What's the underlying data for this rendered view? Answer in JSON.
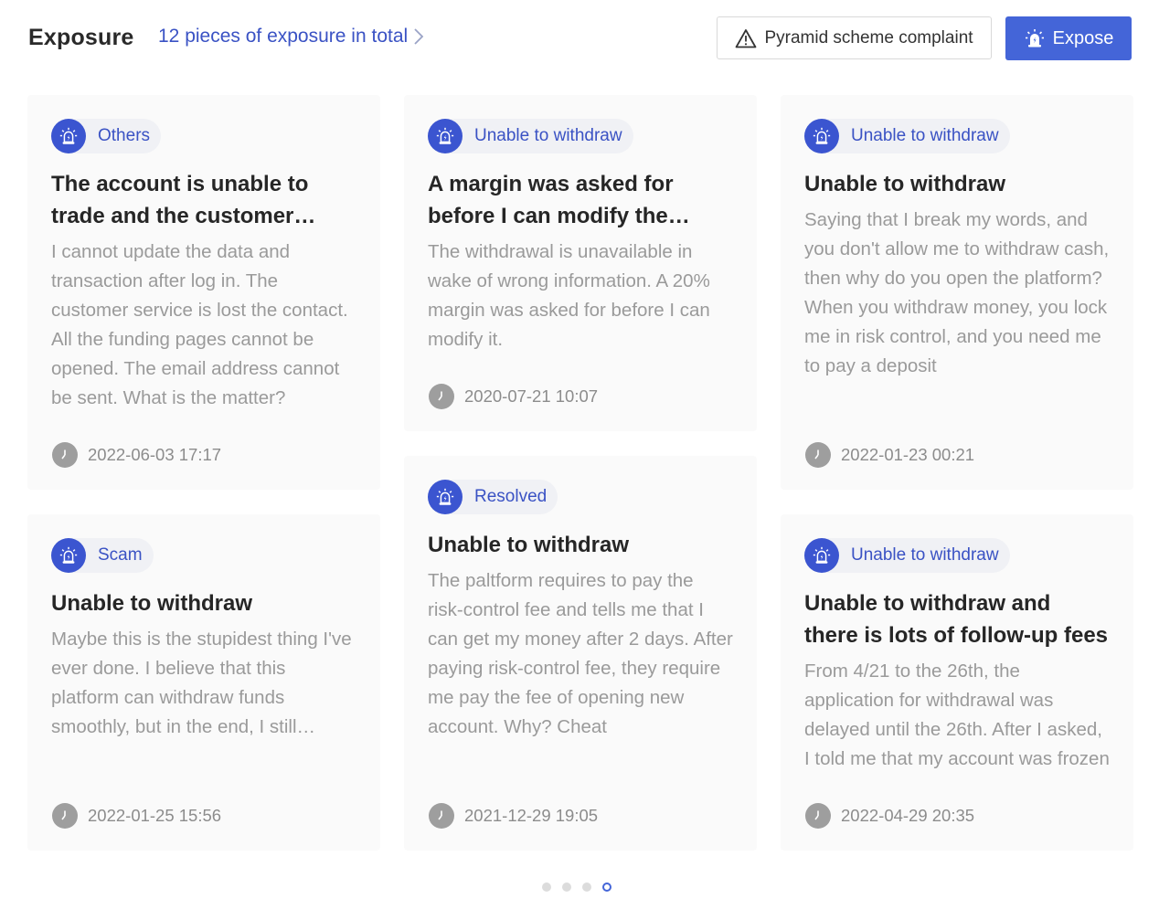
{
  "header": {
    "title": "Exposure",
    "total_link": "12 pieces of exposure in total",
    "complaint_button": "Pyramid scheme complaint",
    "expose_button": "Expose"
  },
  "colors": {
    "accent": "#4465d8",
    "tag_text": "#3a52c4",
    "body_text": "#9a9a9a",
    "card_bg": "#fafafa"
  },
  "cards": [
    {
      "tag": "Others",
      "title": "The account is unable to trade and the customer service is lost the contact",
      "body": "I cannot update the data and transaction after log in. The customer service is lost the contact. All the funding pages cannot be opened. The email address cannot be sent. What is the matter?",
      "time": "2022-06-03 17:17"
    },
    {
      "tag": "Unable to withdraw",
      "title": "A margin was asked for before I can modify the information",
      "body": "The withdrawal is unavailable in wake of wrong information. A 20% margin was asked for before I can modify it.",
      "time": "2020-07-21 10:07"
    },
    {
      "tag": "Unable to withdraw",
      "title": "Unable to withdraw",
      "body": "Saying that I break my words, and you don't allow me to withdraw cash, then why do you open the platform? When you withdraw money, you lock me in risk control, and you need me to pay a deposit",
      "time": "2022-01-23 00:21"
    },
    {
      "tag": "Scam",
      "title": "Unable to withdraw",
      "body": "Maybe this is the stupidest thing I've ever done. I believe that this platform can withdraw funds smoothly, but in the end, I still cannot withdraw",
      "time": "2022-01-25 15:56"
    },
    {
      "tag": "Resolved",
      "title": "Unable to withdraw",
      "body": "The paltform requires to pay the risk-control fee and tells me that I can get my money after 2 days. After paying risk-control fee, they require me pay the fee of opening new account. Why? Cheat",
      "time": "2021-12-29 19:05"
    },
    {
      "tag": "Unable to withdraw",
      "title": "Unable to withdraw and there is lots of follow-up fees",
      "body": "From 4/21 to the 26th, the application for withdrawal was delayed until the 26th. After I asked, I told me that my account was frozen",
      "time": "2022-04-29 20:35"
    }
  ],
  "pagination": {
    "total_pages": 4,
    "active_page": 4
  }
}
